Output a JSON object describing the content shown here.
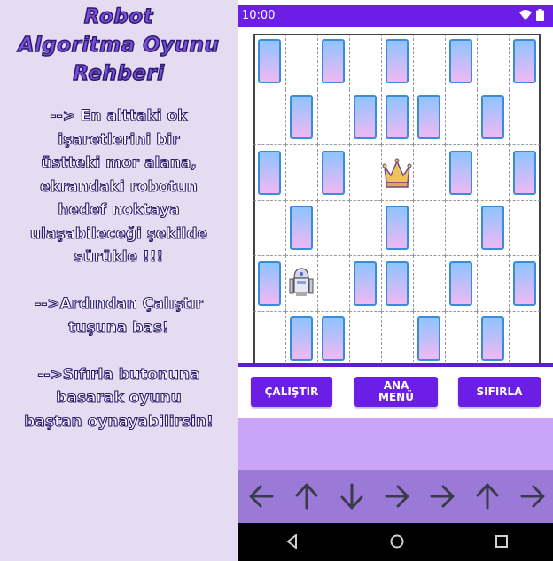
{
  "guide": {
    "title_lines": [
      "Robot",
      "Algoritma Oyunu",
      "Rehberi"
    ],
    "body_lines": [
      "--> En alttaki ok",
      "işaretlerini bir",
      "üstteki mor alana,",
      "ekrandaki robotun",
      "hedef noktaya",
      "ulaşabileceği şekilde",
      "sürükle !!!",
      "",
      "-->Ardından Çalıştır",
      "tuşuna bas!",
      "",
      "-->Sıfırla butonuna",
      "basarak oyunu",
      "baştan oynayabilirsin!"
    ]
  },
  "status": {
    "time": "10:00"
  },
  "buttons": {
    "run": "ÇALIŞTIR",
    "menu_line1": "ANA",
    "menu_line2": "MENÜ",
    "reset": "SIFIRLA"
  },
  "board": {
    "rows": 6,
    "cols": 9,
    "cards": [
      [
        0,
        0
      ],
      [
        0,
        2
      ],
      [
        0,
        4
      ],
      [
        0,
        6
      ],
      [
        0,
        8
      ],
      [
        1,
        1
      ],
      [
        1,
        3
      ],
      [
        1,
        4
      ],
      [
        1,
        5
      ],
      [
        1,
        7
      ],
      [
        2,
        0
      ],
      [
        2,
        2
      ],
      [
        2,
        6
      ],
      [
        2,
        8
      ],
      [
        3,
        1
      ],
      [
        3,
        4
      ],
      [
        3,
        7
      ],
      [
        4,
        0
      ],
      [
        4,
        3
      ],
      [
        4,
        4
      ],
      [
        4,
        6
      ],
      [
        4,
        8
      ],
      [
        5,
        1
      ],
      [
        5,
        2
      ],
      [
        5,
        5
      ],
      [
        5,
        7
      ]
    ],
    "robot": [
      4,
      1
    ],
    "crown": [
      2,
      4
    ]
  },
  "arrows": [
    "left",
    "up",
    "down",
    "right",
    "right",
    "up",
    "right"
  ],
  "colors": {
    "primary": "#6a1ee6",
    "program_area": "#c9a4f7",
    "arrow_bar": "#9a7ad6"
  }
}
